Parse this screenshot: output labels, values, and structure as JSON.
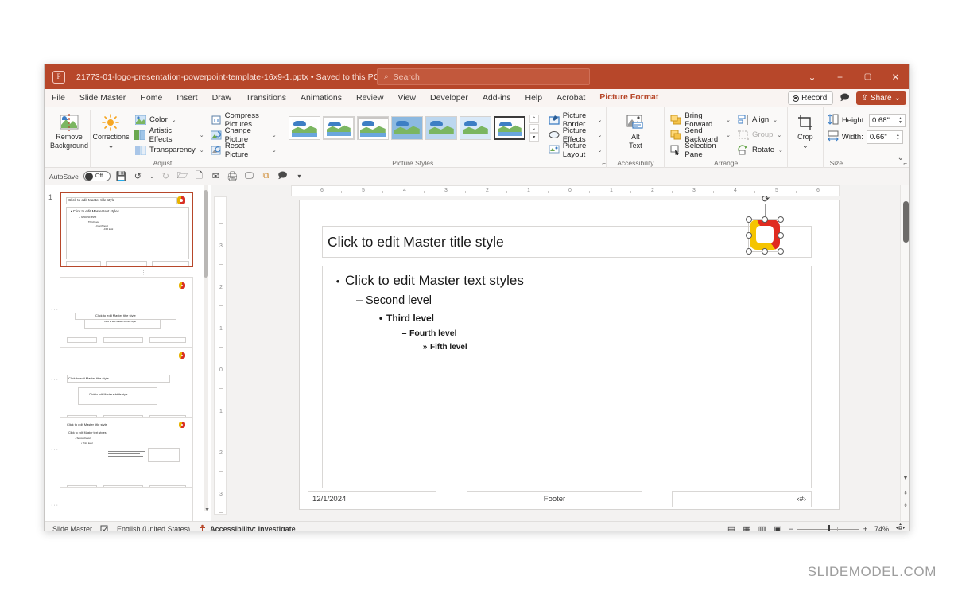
{
  "titlebar": {
    "app_icon": "powerpoint-icon",
    "filename": "21773-01-logo-presentation-powerpoint-template-16x9-1.pptx",
    "separator": "•",
    "saved_state": "Saved to this PC",
    "chevron": "⌄",
    "search_placeholder": "Search",
    "search_icon": "search-icon",
    "win_buttons": {
      "help": "⌄",
      "minimize": "−",
      "maximize": "▢",
      "close": "✕"
    }
  },
  "tabs": [
    {
      "label": "File",
      "active": false
    },
    {
      "label": "Slide Master",
      "active": false
    },
    {
      "label": "Home",
      "active": false
    },
    {
      "label": "Insert",
      "active": false
    },
    {
      "label": "Draw",
      "active": false
    },
    {
      "label": "Transitions",
      "active": false
    },
    {
      "label": "Animations",
      "active": false
    },
    {
      "label": "Review",
      "active": false
    },
    {
      "label": "View",
      "active": false
    },
    {
      "label": "Developer",
      "active": false
    },
    {
      "label": "Add-ins",
      "active": false
    },
    {
      "label": "Help",
      "active": false
    },
    {
      "label": "Acrobat",
      "active": false
    },
    {
      "label": "Picture Format",
      "active": true
    }
  ],
  "tabs_right": {
    "record_label": "Record",
    "comments_icon": "comment-icon",
    "share_label": "Share",
    "share_chevron": "⌄",
    "accent_color": "#b7472a"
  },
  "ribbon": {
    "groups": [
      {
        "name": "Adjust",
        "label": "Adjust",
        "big_buttons": [
          {
            "label_line1": "Remove",
            "label_line2": "Background",
            "icon": "remove-background-icon"
          },
          {
            "label_line1": "Corrections",
            "label_line2": "⌄",
            "icon": "corrections-icon"
          }
        ],
        "items_col1": [
          {
            "label": "Color",
            "icon": "color-icon",
            "chevron": "⌄"
          },
          {
            "label": "Artistic Effects",
            "icon": "artistic-effects-icon",
            "chevron": "⌄"
          },
          {
            "label": "Transparency",
            "icon": "transparency-icon",
            "chevron": "⌄"
          }
        ],
        "items_col2": [
          {
            "label": "Compress Pictures",
            "icon": "compress-pictures-icon",
            "chevron": ""
          },
          {
            "label": "Change Picture",
            "icon": "change-picture-icon",
            "chevron": "⌄"
          },
          {
            "label": "Reset Picture",
            "icon": "reset-picture-icon",
            "chevron": "⌄"
          }
        ]
      },
      {
        "name": "Picture Styles",
        "label": "Picture Styles",
        "gallery_count": 7,
        "selected_index": 6,
        "scroll_up": "⌃",
        "scroll_down": "⌄",
        "scroll_more": "▾"
      },
      {
        "name": "Picture Border Group",
        "label": "",
        "items": [
          {
            "label": "Picture Border",
            "icon": "picture-border-icon",
            "chevron": "⌄"
          },
          {
            "label": "Picture Effects",
            "icon": "picture-effects-icon",
            "chevron": "⌄"
          },
          {
            "label": "Picture Layout",
            "icon": "picture-layout-icon",
            "chevron": "⌄"
          }
        ]
      },
      {
        "name": "Accessibility",
        "label": "Accessibility",
        "big_buttons": [
          {
            "label_line1": "Alt",
            "label_line2": "Text",
            "icon": "alt-text-icon"
          }
        ],
        "dialog_launcher": "⌐"
      },
      {
        "name": "Arrange",
        "label": "Arrange",
        "items_col1": [
          {
            "label": "Bring Forward",
            "icon": "bring-forward-icon",
            "chevron": "⌄",
            "disabled": false
          },
          {
            "label": "Send Backward",
            "icon": "send-backward-icon",
            "chevron": "⌄",
            "disabled": false
          },
          {
            "label": "Selection Pane",
            "icon": "selection-pane-icon",
            "chevron": "",
            "disabled": false
          }
        ],
        "items_col2": [
          {
            "label": "Align",
            "icon": "align-icon",
            "chevron": "⌄",
            "disabled": false
          },
          {
            "label": "Group",
            "icon": "group-icon",
            "chevron": "⌄",
            "disabled": true
          },
          {
            "label": "Rotate",
            "icon": "rotate-icon",
            "chevron": "⌄",
            "disabled": false
          }
        ]
      },
      {
        "name": "Crop",
        "label": "",
        "big_buttons": [
          {
            "label_line1": "Crop",
            "label_line2": "⌄",
            "icon": "crop-icon"
          }
        ]
      },
      {
        "name": "Size",
        "label": "Size",
        "height_label": "Height:",
        "height_value": "0.68\"",
        "width_label": "Width:",
        "width_value": "0.66\"",
        "dialog_launcher": "⌐"
      }
    ],
    "collapse_icon": "⌄"
  },
  "quick_access": {
    "autosave_label": "AutoSave",
    "autosave_state": "Off",
    "buttons": [
      {
        "icon": "save-icon",
        "glyph": "💾"
      },
      {
        "icon": "undo-icon",
        "glyph": "↺"
      },
      {
        "icon": "undo-chevron-icon",
        "glyph": "⌄"
      },
      {
        "icon": "redo-icon",
        "glyph": "↻"
      },
      {
        "icon": "open-icon",
        "glyph": "🗁"
      },
      {
        "icon": "new-file-icon",
        "glyph": "🗋"
      },
      {
        "icon": "email-icon",
        "glyph": "✉"
      },
      {
        "icon": "quick-print-icon",
        "glyph": "🖨"
      },
      {
        "icon": "start-slideshow-icon",
        "glyph": "🖵"
      },
      {
        "icon": "duplicate-icon",
        "glyph": "⧉"
      },
      {
        "icon": "comment-icon",
        "glyph": "🗩"
      },
      {
        "icon": "customize-qat-icon",
        "glyph": "▾"
      }
    ]
  },
  "thumbnails": {
    "items": [
      {
        "number": "1",
        "selected": true,
        "type": "master",
        "title": "Click to edit Master title style",
        "body": "Click to edit Master text styles"
      },
      {
        "number": "",
        "selected": false,
        "type": "title-centered",
        "title": "Click to edit Master title style",
        "subtitle": "Click to edit Master subtitle style"
      },
      {
        "number": "",
        "selected": false,
        "type": "title-slide",
        "title": "Click to edit Master title style",
        "subtitle": "Click to edit Master subtitle style"
      },
      {
        "number": "",
        "selected": false,
        "type": "content-two",
        "title": "Click to edit Master title style",
        "body": "Click to edit Master text styles"
      },
      {
        "number": "",
        "selected": false,
        "type": "partial",
        "title": "",
        "body": ""
      }
    ],
    "scroll_up_icon": "▲",
    "scroll_down_icon": "▼"
  },
  "rulers": {
    "horizontal": [
      "6",
      "5",
      "4",
      "3",
      "2",
      "1",
      "0",
      "1",
      "2",
      "3",
      "4",
      "5",
      "6"
    ],
    "vertical": [
      "3",
      "2",
      "1",
      "0",
      "1",
      "2",
      "3"
    ]
  },
  "slide": {
    "title_placeholder": "Click to edit Master title style",
    "body_levels": [
      {
        "bullet": "•",
        "text": "Click to edit Master text styles"
      },
      {
        "bullet": "–",
        "text": "Second level"
      },
      {
        "bullet": "•",
        "text": "Third level"
      },
      {
        "bullet": "–",
        "text": "Fourth level"
      },
      {
        "bullet": "»",
        "text": "Fifth level"
      }
    ],
    "footer_date": "12/1/2024",
    "footer_text": "Footer",
    "footer_slidenum": "‹#›",
    "selected_image": {
      "name": "logo-image",
      "rotate_handle_icon": "rotate-handle-icon",
      "colors": {
        "red": "#e02b20",
        "yellow": "#f5c400"
      }
    }
  },
  "scrollbar": {
    "prev_slide_icon": "▼",
    "double_up_icon": "⇞",
    "double_down_icon": "⇟"
  },
  "statusbar": {
    "view_name": "Slide Master",
    "spell_icon": "spell-check-icon",
    "language": "English (United States)",
    "accessibility_icon": "accessibility-icon",
    "accessibility_text": "Accessibility: Investigate",
    "view_buttons": [
      {
        "icon": "normal-view-icon",
        "glyph": "▤"
      },
      {
        "icon": "slide-sorter-icon",
        "glyph": "▦"
      },
      {
        "icon": "reading-view-icon",
        "glyph": "▥"
      },
      {
        "icon": "slideshow-icon",
        "glyph": "▣"
      }
    ],
    "zoom_out": "−",
    "zoom_in": "+",
    "zoom_level": "74%",
    "fit_icon": "fit-to-window-icon"
  },
  "watermark": "SLIDEMODEL.COM"
}
